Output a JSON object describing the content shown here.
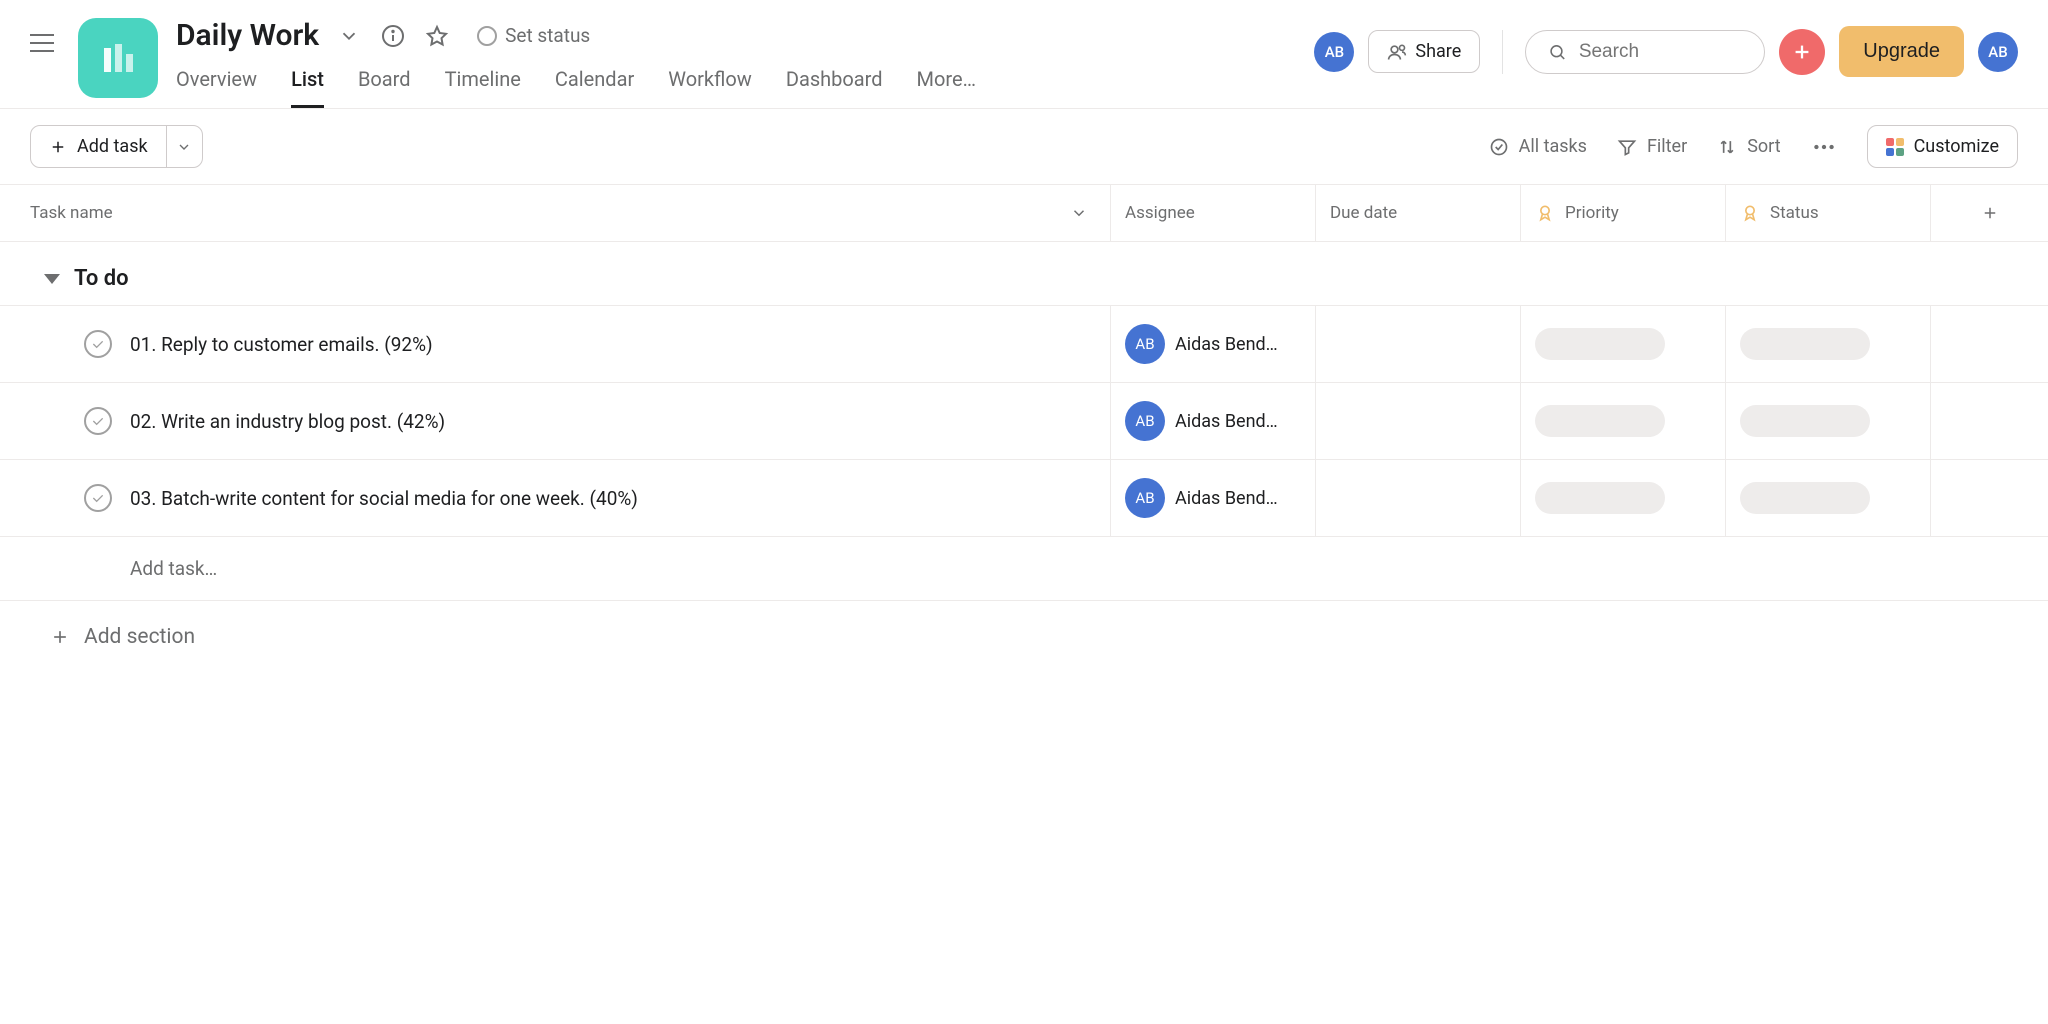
{
  "header": {
    "project_title": "Daily Work",
    "set_status": "Set status",
    "share": "Share",
    "search_placeholder": "Search",
    "upgrade": "Upgrade",
    "avatar_initials": "AB"
  },
  "tabs": {
    "overview": "Overview",
    "list": "List",
    "board": "Board",
    "timeline": "Timeline",
    "calendar": "Calendar",
    "workflow": "Workflow",
    "dashboard": "Dashboard",
    "more": "More…",
    "active": "list"
  },
  "toolbar": {
    "add_task": "Add task",
    "all_tasks": "All tasks",
    "filter": "Filter",
    "sort": "Sort",
    "customize": "Customize"
  },
  "columns": {
    "task_name": "Task name",
    "assignee": "Assignee",
    "due_date": "Due date",
    "priority": "Priority",
    "status": "Status"
  },
  "section": {
    "title": "To do",
    "add_task_inline": "Add task…",
    "add_section": "Add section"
  },
  "tasks": [
    {
      "name": "01. Reply to customer emails. (92%)",
      "assignee_initials": "AB",
      "assignee_name": "Aidas Bend…"
    },
    {
      "name": "02. Write an industry blog post. (42%)",
      "assignee_initials": "AB",
      "assignee_name": "Aidas Bend…"
    },
    {
      "name": "03. Batch-write content for social media for one week. (40%)",
      "assignee_initials": "AB",
      "assignee_name": "Aidas Bend…"
    }
  ]
}
